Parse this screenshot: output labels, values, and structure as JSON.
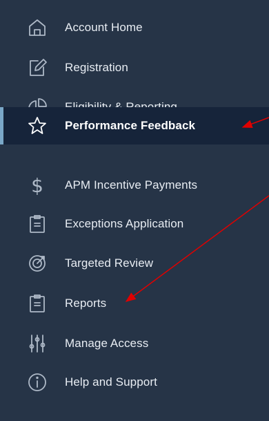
{
  "sidebar": {
    "items": [
      {
        "label": "Account Home",
        "icon": "home-icon"
      },
      {
        "label": "Registration",
        "icon": "edit-icon"
      },
      {
        "label": "Eligibility & Reporting",
        "icon": "pie-chart-icon"
      },
      {
        "label": "Performance Feedback",
        "icon": "star-icon",
        "active": true
      },
      {
        "label": "APM Incentive Payments",
        "icon": "dollar-icon"
      },
      {
        "label": "Exceptions Application",
        "icon": "clipboard-icon"
      },
      {
        "label": "Targeted Review",
        "icon": "target-review-icon"
      },
      {
        "label": "Reports",
        "icon": "clipboard-icon"
      },
      {
        "label": "Manage Access",
        "icon": "sliders-icon"
      },
      {
        "label": "Help and Support",
        "icon": "info-icon"
      }
    ]
  },
  "colors": {
    "background": "#263447",
    "active_background": "#16243a",
    "active_indicator": "#7aa7c7",
    "annotation_arrow": "#e00000"
  }
}
